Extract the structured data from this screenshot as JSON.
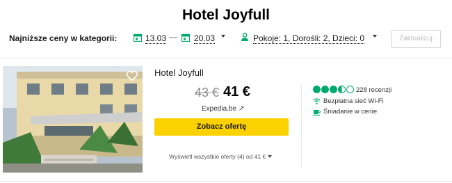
{
  "page": {
    "title": "Hotel Joyfull"
  },
  "filters": {
    "label": "Najniższe ceny w kategorii:",
    "checkin": "13.03",
    "separator": "—",
    "checkout": "20.03",
    "guests": "Pokoje: 1, Dorośli: 2, Dzieci: 0",
    "update_label": "Zaktualizuj"
  },
  "listing": {
    "name": "Hotel Joyfull",
    "old_price": "43 €",
    "price": "41 €",
    "provider": "Expedia.be ↗",
    "cta": "Zobacz ofertę",
    "all_offers": "Wyświetl wszystkie oferty (4) od 41 €",
    "rating": {
      "value": 3.5,
      "max": 5
    },
    "reviews": "228 recenzji",
    "amenities": [
      {
        "icon": "wifi-icon",
        "label": "Bezpłatna sieć Wi-Fi"
      },
      {
        "icon": "breakfast-icon",
        "label": "Śniadanie w cenie"
      }
    ]
  },
  "colors": {
    "cta": "#fcd100",
    "rating": "#00aa6c",
    "accent_icon": "#00aa6c"
  }
}
